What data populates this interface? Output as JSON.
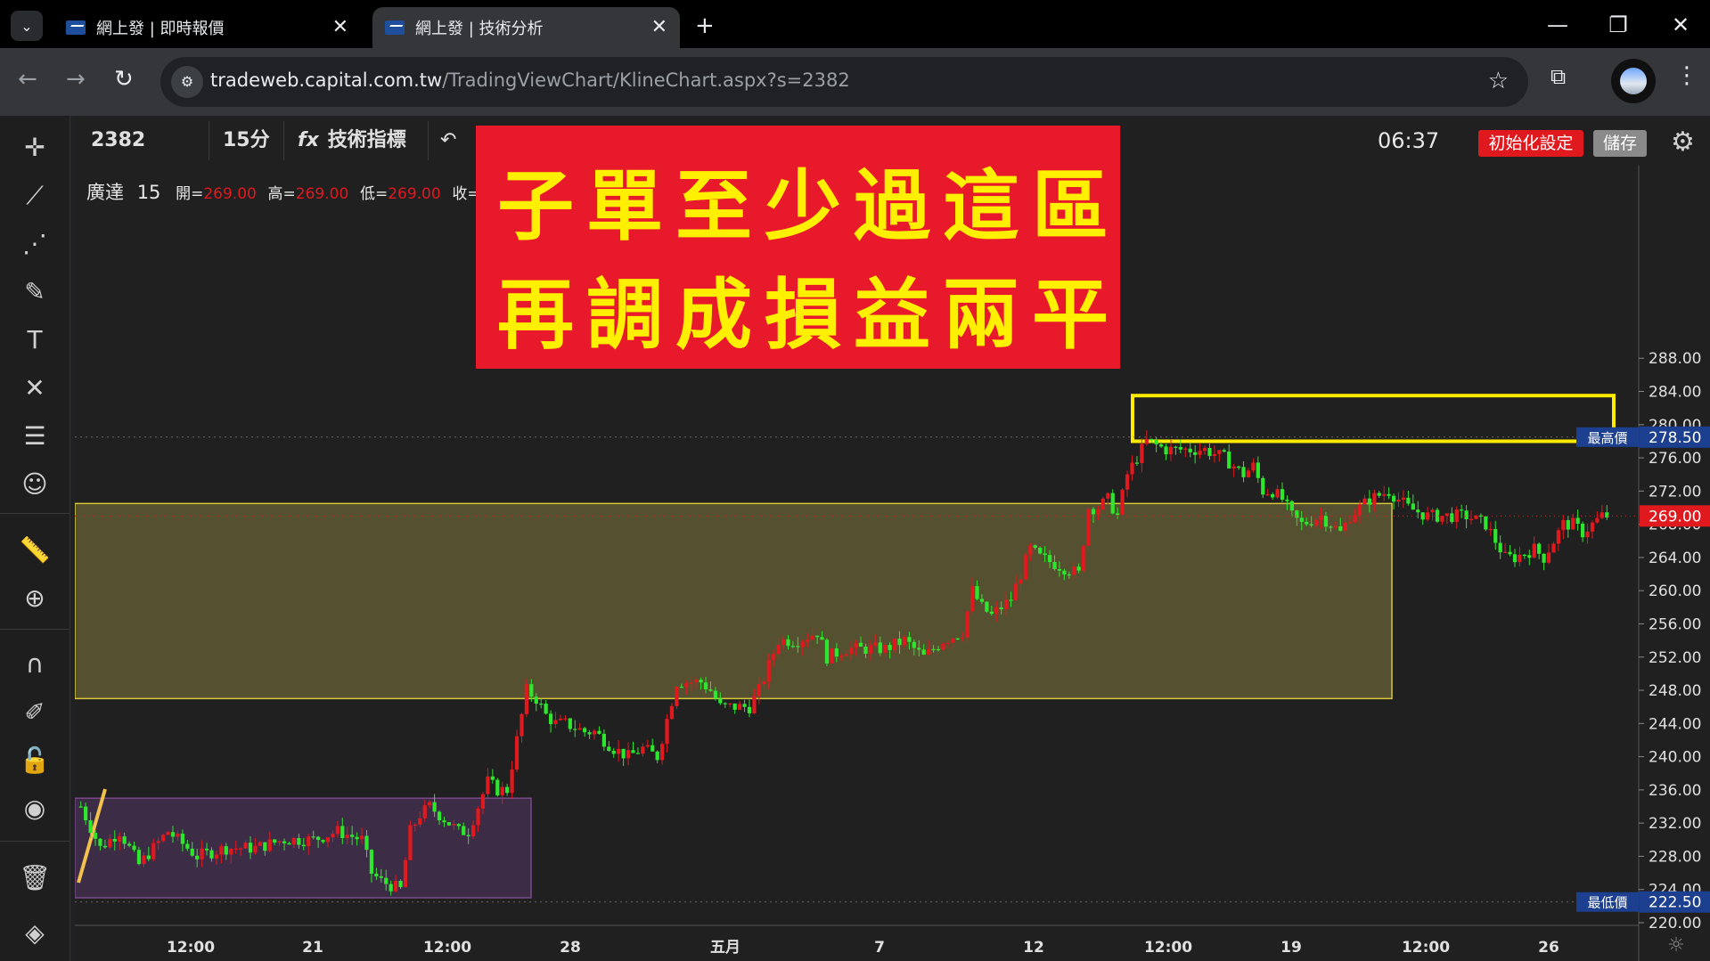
{
  "browser": {
    "tabs": [
      {
        "title": "網上發 | 即時報價"
      },
      {
        "title": "網上發 | 技術分析"
      }
    ],
    "url_host": "tradeweb.capital.com.tw",
    "url_path": "/TradingViewChart/KlineChart.aspx?s=2382"
  },
  "topbar": {
    "symbol": "2382",
    "interval": "15分",
    "indicators_label": "技術指標",
    "time": "06:37",
    "init_label": "初始化設定",
    "save_label": "儲存"
  },
  "legend": {
    "name": "廣達",
    "interval": "15",
    "open_label": "開=",
    "open": "269.00",
    "high_label": "高=",
    "high": "269.00",
    "low_label": "低=",
    "low": "269.00",
    "close_label": "收="
  },
  "banner": {
    "line1": "子單至少過這區",
    "line2": "再調成損益兩平"
  },
  "colors": {
    "up": "#e0191f",
    "down": "#2ee62e",
    "banner_bg": "#e8192a",
    "banner_text": "#ffef00",
    "zone_yellow": "#55502f",
    "zone_purple": "#3d2c45"
  },
  "chart_data": {
    "type": "candlestick",
    "ylim": [
      218,
      290
    ],
    "y_ticks": [
      220,
      224,
      228,
      232,
      236,
      240,
      244,
      248,
      252,
      256,
      260,
      264,
      268,
      272,
      276,
      280,
      284,
      288
    ],
    "y_tick_labels": [
      "220.00",
      "224.00",
      "228.00",
      "232.00",
      "236.00",
      "240.00",
      "244.00",
      "248.00",
      "252.00",
      "256.00",
      "260.00",
      "264.00",
      "268.00",
      "272.00",
      "276.00",
      "280.00",
      "284.00",
      "288.00"
    ],
    "x_tick_labels": [
      "12:00",
      "21",
      "12:00",
      "28",
      "五月",
      "7",
      "12",
      "12:00",
      "19",
      "12:00",
      "26"
    ],
    "price_tags": {
      "high_label": "最高價",
      "high": 278.5,
      "low_label": "最低價",
      "low": 222.5,
      "last": 269.0
    },
    "zones": [
      {
        "name": "yellow-zone",
        "from": 247,
        "to": 270.5
      },
      {
        "name": "purple-zone",
        "from": 223,
        "to": 235
      },
      {
        "name": "target-box",
        "from": 278,
        "to": 283.5
      }
    ],
    "close_path": [
      [
        0,
        234
      ],
      [
        4,
        229
      ],
      [
        8,
        231
      ],
      [
        12,
        227
      ],
      [
        18,
        231
      ],
      [
        24,
        228
      ],
      [
        30,
        229
      ],
      [
        36,
        229
      ],
      [
        42,
        230
      ],
      [
        48,
        230
      ],
      [
        53,
        231
      ],
      [
        58,
        230
      ],
      [
        60,
        226
      ],
      [
        62,
        225
      ],
      [
        66,
        224
      ],
      [
        68,
        231
      ],
      [
        70,
        233
      ],
      [
        72,
        234
      ],
      [
        74,
        233
      ],
      [
        76,
        232
      ],
      [
        78,
        231
      ],
      [
        80,
        231
      ],
      [
        84,
        237
      ],
      [
        86,
        236
      ],
      [
        88,
        236
      ],
      [
        92,
        248
      ],
      [
        94,
        247
      ],
      [
        96,
        245
      ],
      [
        98,
        244
      ],
      [
        100,
        244
      ],
      [
        104,
        243
      ],
      [
        106,
        243
      ],
      [
        108,
        242
      ],
      [
        110,
        241
      ],
      [
        113,
        240
      ],
      [
        116,
        241
      ],
      [
        119,
        240
      ],
      [
        123,
        249
      ],
      [
        128,
        249
      ],
      [
        130,
        248
      ],
      [
        132,
        246
      ],
      [
        138,
        246
      ],
      [
        140,
        248
      ],
      [
        144,
        254
      ],
      [
        148,
        254
      ],
      [
        152,
        255
      ],
      [
        154,
        252
      ],
      [
        158,
        253
      ],
      [
        162,
        253
      ],
      [
        166,
        253
      ],
      [
        170,
        254
      ],
      [
        174,
        252
      ],
      [
        178,
        254
      ],
      [
        182,
        255
      ],
      [
        184,
        260
      ],
      [
        186,
        258
      ],
      [
        188,
        257
      ],
      [
        192,
        259
      ],
      [
        196,
        265
      ],
      [
        198,
        264
      ],
      [
        202,
        263
      ],
      [
        206,
        262
      ],
      [
        208,
        270
      ],
      [
        210,
        270
      ],
      [
        212,
        271
      ],
      [
        214,
        269
      ],
      [
        216,
        274
      ],
      [
        220,
        278
      ],
      [
        224,
        277
      ],
      [
        228,
        277
      ],
      [
        232,
        277
      ],
      [
        236,
        276
      ],
      [
        238,
        275
      ],
      [
        240,
        274
      ],
      [
        242,
        275
      ],
      [
        244,
        272
      ],
      [
        246,
        272
      ],
      [
        248,
        271
      ],
      [
        250,
        269
      ],
      [
        252,
        268
      ],
      [
        256,
        269
      ],
      [
        260,
        267
      ],
      [
        262,
        269
      ],
      [
        266,
        271
      ],
      [
        270,
        272
      ],
      [
        274,
        270
      ],
      [
        278,
        269
      ],
      [
        282,
        269
      ],
      [
        286,
        269
      ],
      [
        290,
        268
      ],
      [
        292,
        266
      ],
      [
        294,
        264
      ],
      [
        296,
        264
      ],
      [
        300,
        265
      ],
      [
        302,
        264
      ],
      [
        304,
        266
      ],
      [
        306,
        268
      ],
      [
        308,
        268
      ],
      [
        310,
        267
      ],
      [
        312,
        268
      ],
      [
        314,
        269
      ]
    ],
    "n_bars": 316
  }
}
